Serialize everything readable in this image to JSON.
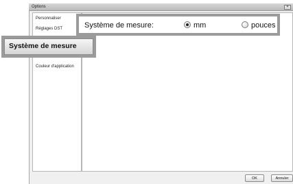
{
  "window": {
    "title": "Options"
  },
  "sidebar": {
    "items": [
      {
        "label": "Personnaliser"
      },
      {
        "label": "Réglages DST"
      },
      {
        "label": "Système de mesure",
        "selected": true
      },
      {
        "label": "Couleur d'application"
      }
    ]
  },
  "measure": {
    "label": "Système de mesure:",
    "options": [
      {
        "label": "mm",
        "selected": true
      },
      {
        "label": "pouces",
        "selected": false
      }
    ]
  },
  "buttons": {
    "ok": "OK",
    "cancel": "Annuler"
  },
  "icons": {
    "close": "close-icon"
  }
}
